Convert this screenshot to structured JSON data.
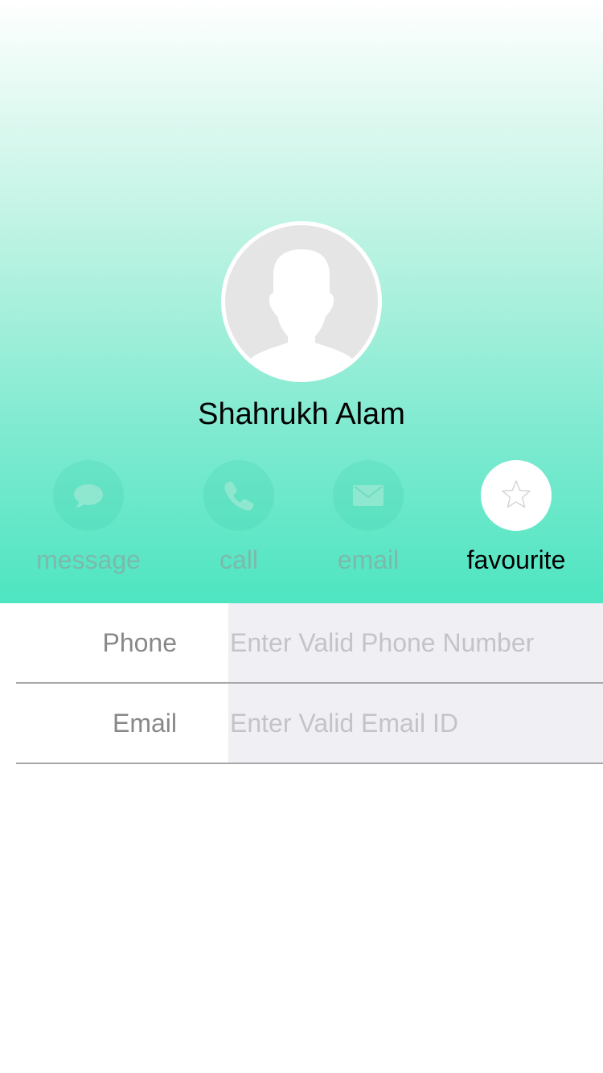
{
  "profile": {
    "name": "Shahrukh Alam"
  },
  "actions": [
    {
      "label": "message",
      "icon": "message-bubble-icon",
      "active": false
    },
    {
      "label": "call",
      "icon": "phone-icon",
      "active": false
    },
    {
      "label": "email",
      "icon": "envelope-icon",
      "active": false
    },
    {
      "label": "favourite",
      "icon": "star-outline-icon",
      "active": true
    }
  ],
  "fields": {
    "phone": {
      "label": "Phone",
      "value": "",
      "placeholder": "Enter Valid Phone Number"
    },
    "email": {
      "label": "Email",
      "value": "",
      "placeholder": "Enter Valid Email ID"
    }
  },
  "colors": {
    "header_gradient_top": "#ffffff",
    "header_gradient_bottom": "#4ee5c1",
    "input_background": "#efeff4",
    "inactive_label": "#b4b4b4",
    "active_label": "#000000"
  }
}
